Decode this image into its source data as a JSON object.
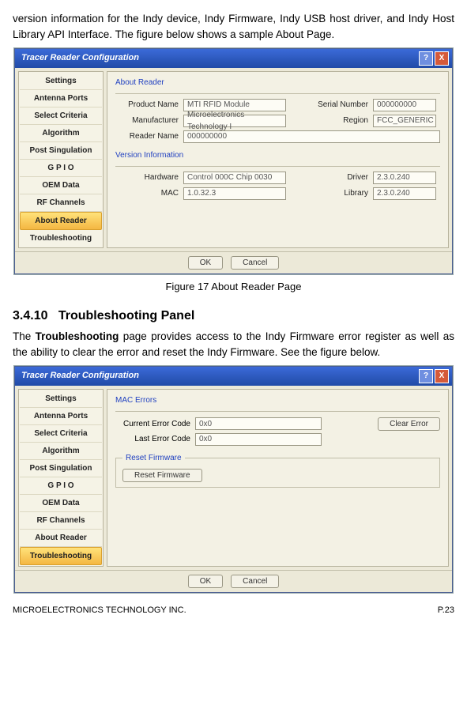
{
  "intro_text": "version information for the Indy device, Indy Firmware, Indy USB host driver, and Indy Host Library API Interface. The figure below shows a sample About Page.",
  "caption1": "Figure 17 About Reader Page",
  "heading_no": "3.4.10",
  "heading_title": "Troubleshooting Panel",
  "para2_pre": "The ",
  "para2_bold": "Troubleshooting",
  "para2_post": " page provides access to the Indy Firmware error register as well as the ability to clear the error and reset the Indy Firmware. See the figure below.",
  "footer_left": "MICROELECTRONICS TECHNOLOGY INC.",
  "footer_right": "P.23",
  "dialog_title": "Tracer Reader Configuration",
  "help_glyph": "?",
  "close_glyph": "X",
  "ok_label": "OK",
  "cancel_label": "Cancel",
  "sidebar_items": [
    "Settings",
    "Antenna Ports",
    "Select Criteria",
    "Algorithm",
    "Post Singulation",
    "G P I O",
    "OEM Data",
    "RF Channels",
    "About Reader",
    "Troubleshooting"
  ],
  "about": {
    "group1": "About Reader",
    "group2": "Version Information",
    "product_lbl": "Product Name",
    "product_val": "MTI RFID Module",
    "serial_lbl": "Serial Number",
    "serial_val": "000000000",
    "manuf_lbl": "Manufacturer",
    "manuf_val": "Microelectronics Technology I",
    "region_lbl": "Region",
    "region_val": "FCC_GENERIC",
    "reader_lbl": "Reader Name",
    "reader_val": "000000000",
    "hardware_lbl": "Hardware",
    "hardware_val": "Control 000C Chip 0030",
    "driver_lbl": "Driver",
    "driver_val": "2.3.0.240",
    "mac_lbl": "MAC",
    "mac_val": "1.0.32.3",
    "library_lbl": "Library",
    "library_val": "2.3.0.240"
  },
  "trouble": {
    "group1": "MAC Errors",
    "group2": "Reset Firmware",
    "cur_lbl": "Current Error Code",
    "cur_val": "0x0",
    "last_lbl": "Last Error Code",
    "last_val": "0x0",
    "clear_btn": "Clear Error",
    "reset_btn": "Reset Firmware"
  }
}
